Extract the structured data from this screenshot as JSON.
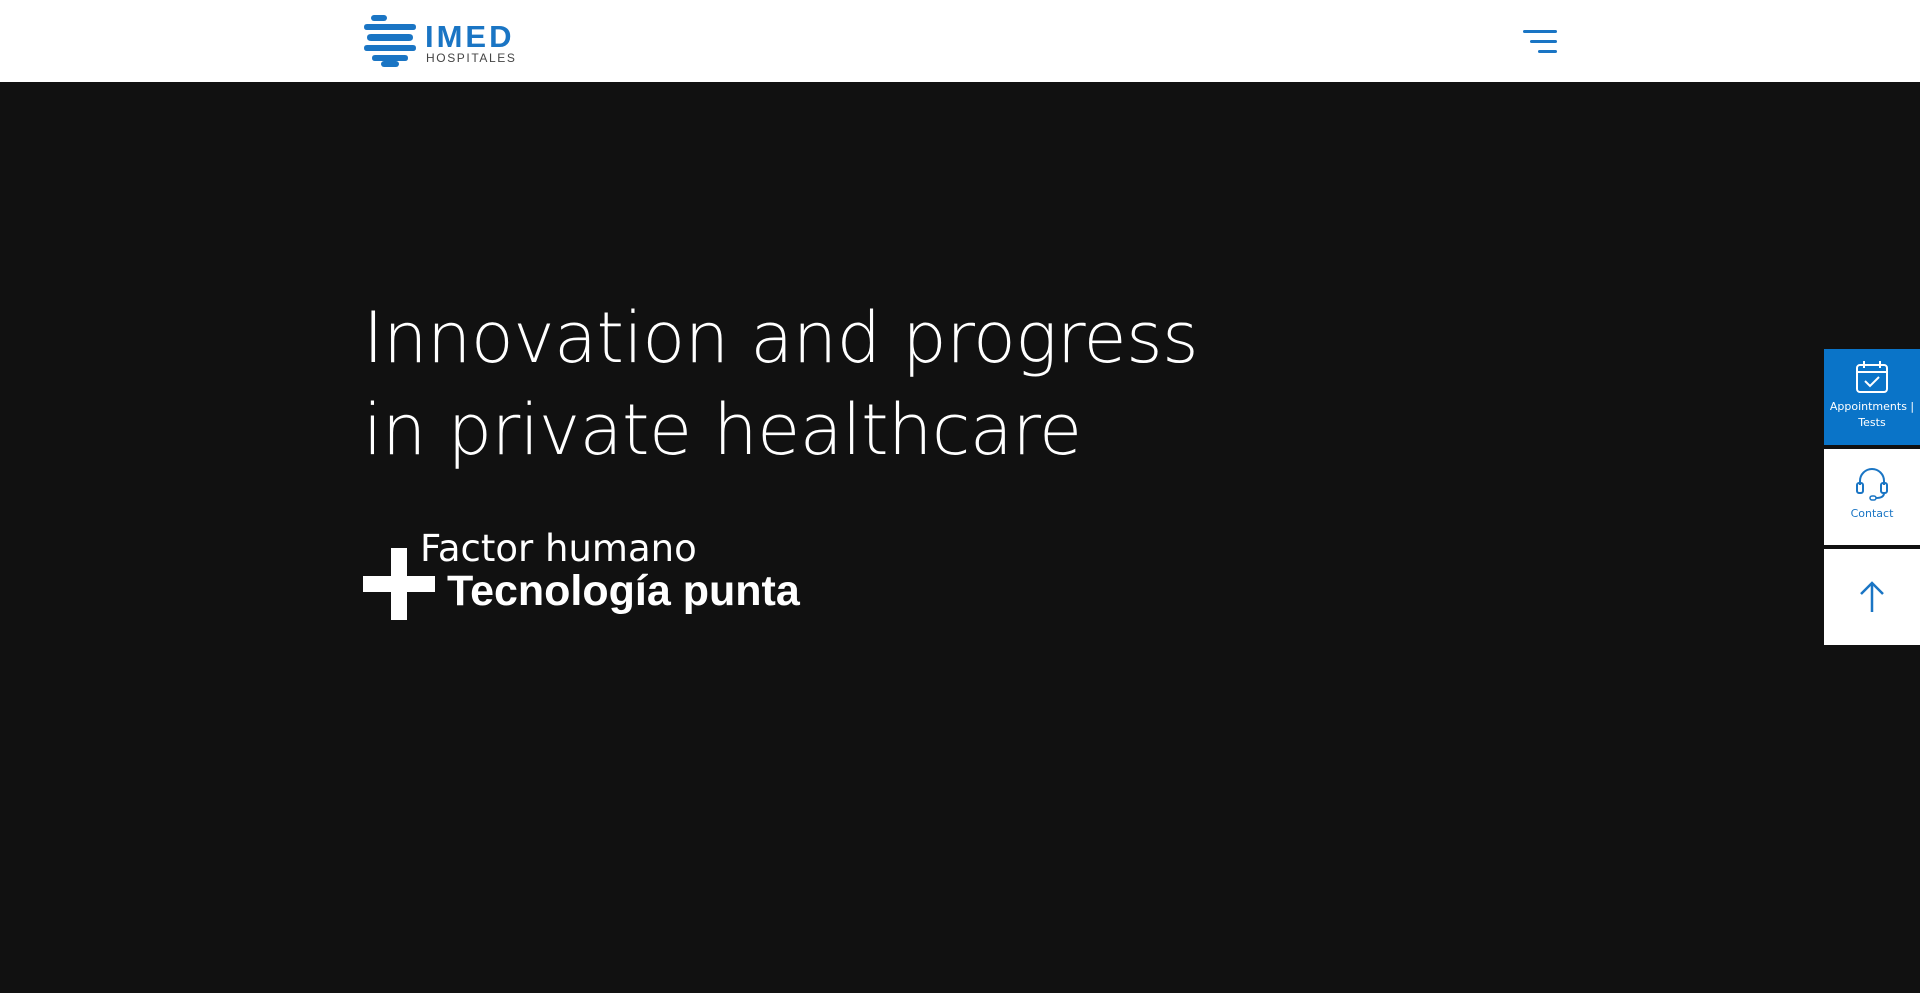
{
  "header": {
    "logo": {
      "name": "IMED",
      "subtitle": "HOSPITALES"
    },
    "menu_icon": "hamburger-menu-icon"
  },
  "hero": {
    "title_line1": "Innovation and progress",
    "title_line2": "in private healthcare",
    "tagline_light": "Factor humano",
    "tagline_bold": "Tecnología punta",
    "tagline_icon": "plus-cross-icon"
  },
  "side_actions": {
    "appointments": {
      "label": "Appointments | Tests",
      "icon": "calendar-check-icon"
    },
    "contact": {
      "label": "Contact",
      "icon": "headset-icon"
    },
    "back_to_top": {
      "icon": "arrow-up-icon"
    }
  },
  "colors": {
    "brand_blue": "#1a75c4",
    "appointments_bg": "#0a74c8",
    "hero_bg": "#111111",
    "header_bg": "#ffffff"
  }
}
